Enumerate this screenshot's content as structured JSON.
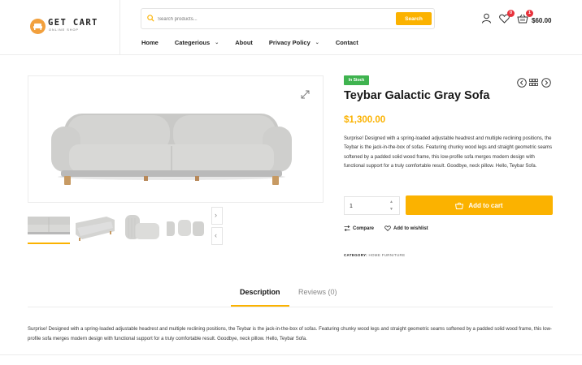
{
  "brand": {
    "name": "GET CART",
    "tagline": "ONLINE SHOP",
    "accent": "#fbb200",
    "logo_color": "#f2a03d"
  },
  "search": {
    "placeholder": "Search products...",
    "button_label": "Search"
  },
  "nav": {
    "items": [
      {
        "label": "Home",
        "has_dropdown": false
      },
      {
        "label": "Categerious",
        "has_dropdown": true
      },
      {
        "label": "About",
        "has_dropdown": false
      },
      {
        "label": "Privacy Policy",
        "has_dropdown": true
      },
      {
        "label": "Contact",
        "has_dropdown": false
      }
    ]
  },
  "header_icons": {
    "account_icon": "user-icon",
    "wishlist_icon": "heart-icon",
    "wishlist_count": "0",
    "cart_icon": "basket-icon",
    "cart_count": "1",
    "cart_total": "$60.00",
    "badge_color": "#e8323c"
  },
  "gallery": {
    "main_image": "sofa-front-view",
    "thumbnails": [
      "sofa-front-view",
      "sofa-angle-view",
      "sofa-side-view",
      "sofa-close-view"
    ],
    "active_thumbnail": 0
  },
  "product": {
    "stock_status": "In Stock",
    "stock_color": "#3fb34f",
    "title": "Teybar Galactic Gray Sofa",
    "price": "$1,300.00",
    "short_description": "Surprise! Designed with a spring-loaded adjustable headrest and multiple reclining positions, the Teybar is the jack-in-the-box of sofas. Featuring chunky wood legs and straight geometric seams softened by a padded solid wood frame, this low-profile sofa merges modern design with functional support for a truly comfortable result. Goodbye, neck pillow. Hello, Teybar Sofa.",
    "quantity": "1",
    "add_to_cart_label": "Add to cart",
    "compare_label": "Compare",
    "wishlist_label": "Add to wishlist",
    "category_label": "CATEGORY:",
    "category_value": "HOME FURNITURE"
  },
  "tabs": {
    "items": [
      {
        "label": "Description",
        "active": true
      },
      {
        "label": "Reviews (0)",
        "active": false
      }
    ],
    "description_text": "Surprise! Designed with a spring-loaded adjustable headrest and multiple reclining positions, the Teybar is the jack-in-the-box of sofas. Featuring chunky wood legs and straight geometric seams softened by a padded solid wood frame, this low-profile sofa merges modern design with functional support for a truly comfortable result. Goodbye, neck pillow. Hello, Teybar Sofa."
  }
}
